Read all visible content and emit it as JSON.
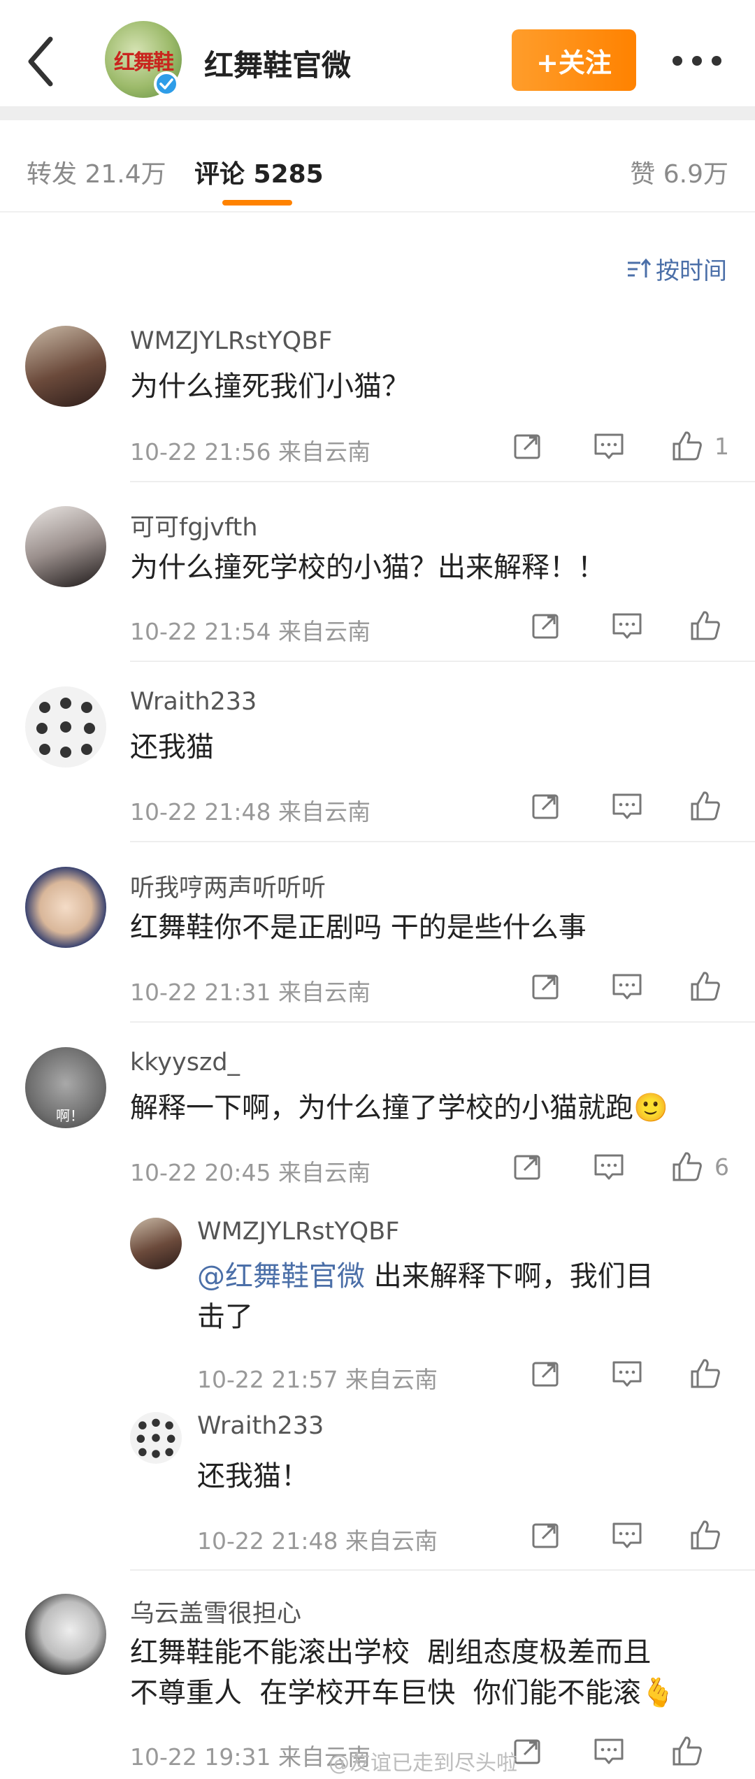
{
  "header": {
    "account_name": "红舞鞋官微",
    "avatar_text": "红舞鞋",
    "follow_label": "+关注"
  },
  "tabs": {
    "repost": "转发 21.4万",
    "comments": "评论 5285",
    "likes": "赞 6.9万"
  },
  "sort_label": "按时间",
  "comments": [
    {
      "name": "WMZJYLRstYQBF",
      "text": "为什么撞死我们小猫？",
      "meta": "10-22 21:56  来自云南",
      "likes": "1"
    },
    {
      "name": "可可fgjvfth",
      "text": "为什么撞死学校的小猫？出来解释！！",
      "meta": "10-22 21:54  来自云南",
      "likes": ""
    },
    {
      "name": "Wraith233",
      "text": "还我猫",
      "meta": "10-22 21:48  来自云南",
      "likes": ""
    },
    {
      "name": "听我哼两声听听听",
      "text": "红舞鞋你不是正剧吗 干的是些什么事",
      "meta": "10-22 21:31  来自云南",
      "likes": ""
    },
    {
      "name": "kkyyszd_",
      "text": "解释一下啊，为什么撞了学校的小猫就跑🙂",
      "meta": "10-22 20:45  来自云南",
      "likes": "6"
    },
    {
      "name": "乌云盖雪很担心",
      "text": "红舞鞋能不能滚出学校  剧组态度极差而且\n不尊重人  在学校开车巨快  你们能不能滚🫰",
      "meta": "10-22 19:31  来自云南",
      "likes": ""
    }
  ],
  "replies": [
    {
      "name": "WMZJYLRstYQBF",
      "mention": "@红舞鞋官微",
      "text": " 出来解释下啊，我们目\n击了",
      "meta": "10-22 21:57  来自云南"
    },
    {
      "name": "Wraith233",
      "text": "还我猫！",
      "meta": "10-22 21:48  来自云南"
    }
  ],
  "avatar_badge": "啊！",
  "watermark": "@友谊已走到尽头啦",
  "icons": [
    "back-arrow-icon",
    "verified-icon",
    "more-icon",
    "sort-icon",
    "repost-icon",
    "comment-icon",
    "like-icon"
  ],
  "colors": {
    "accent": "#ff8200",
    "link": "#4b6fa8",
    "verified": "#2e9de8"
  }
}
